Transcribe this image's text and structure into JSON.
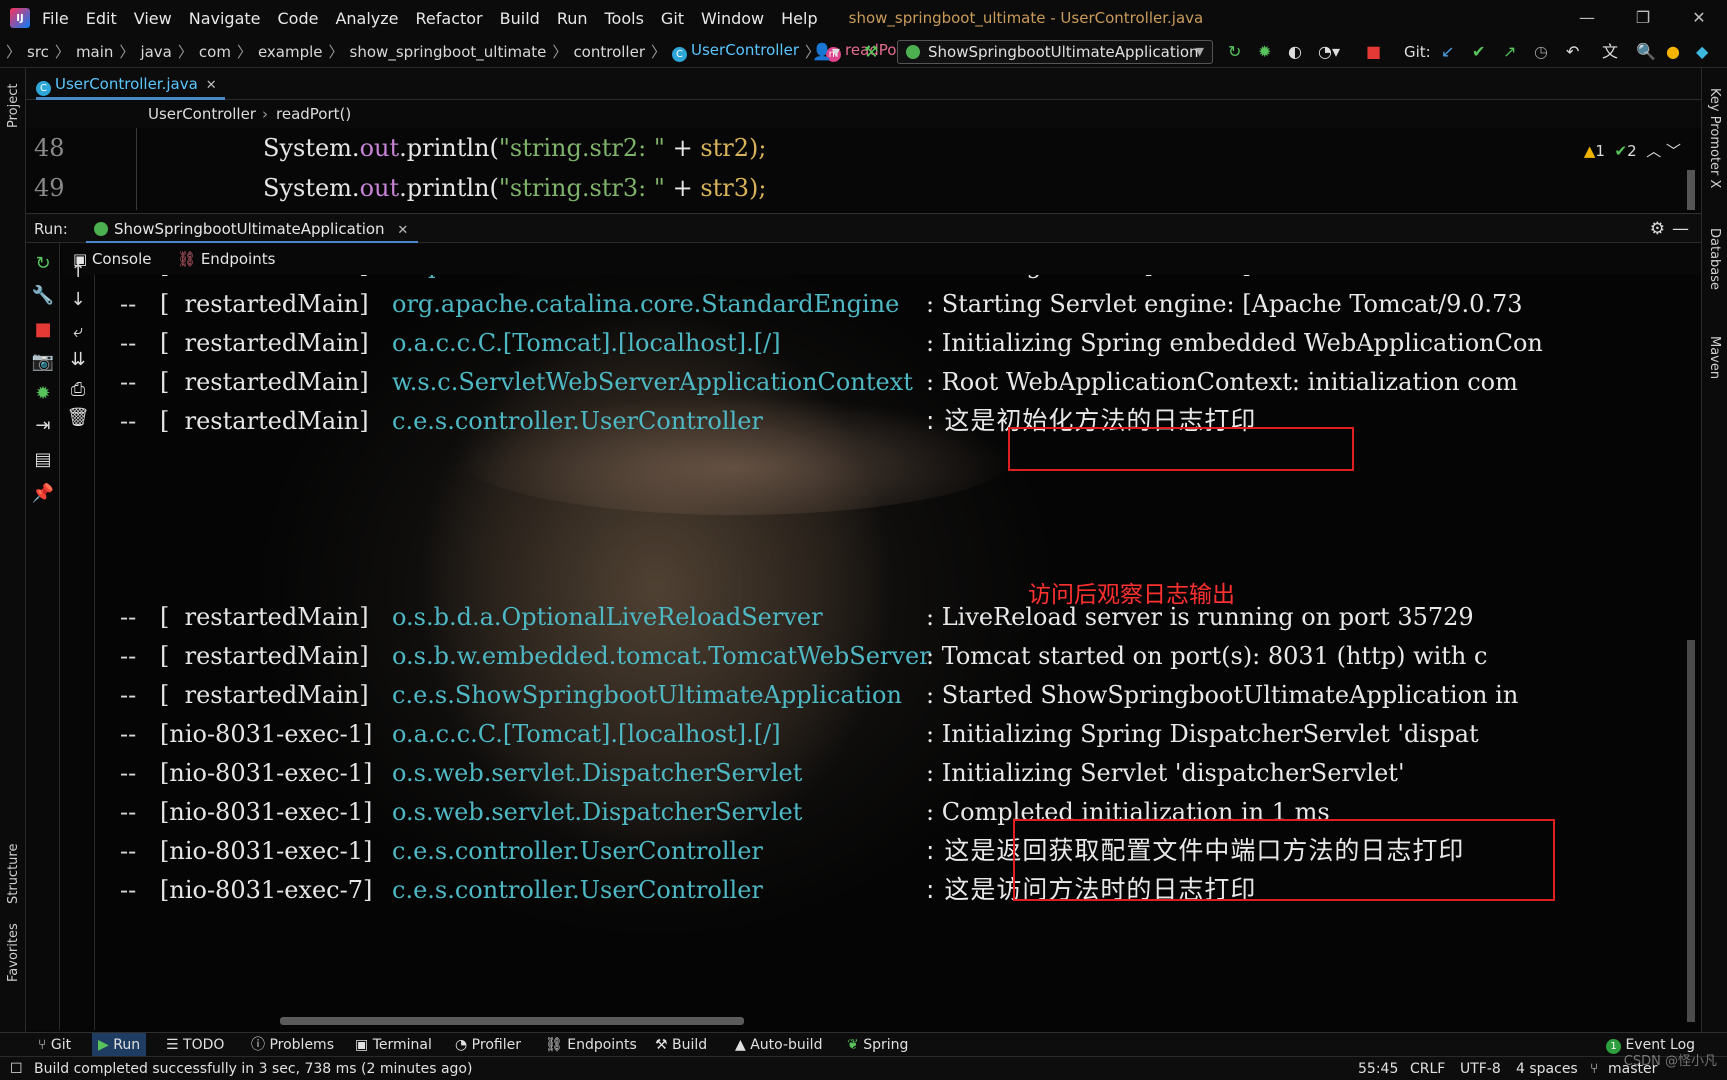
{
  "menu": {
    "items": [
      "File",
      "Edit",
      "View",
      "Navigate",
      "Code",
      "Analyze",
      "Refactor",
      "Build",
      "Run",
      "Tools",
      "Git",
      "Window",
      "Help"
    ],
    "title": "show_springboot_ultimate - UserController.java"
  },
  "window_controls": {
    "minimize": "—",
    "restore": "❐",
    "close": "✕"
  },
  "breadcrumb": [
    "src",
    "main",
    "java",
    "com",
    "example",
    "show_springboot_ultimate",
    "controller",
    "UserController",
    "readPort"
  ],
  "run_config": "ShowSpringbootUltimateApplication",
  "git_label": "Git:",
  "file_tab": {
    "label": "UserController.java",
    "close": "✕"
  },
  "editor_breadcrumb": {
    "class": "UserController",
    "method": "readPort()"
  },
  "code": [
    {
      "line": "48",
      "prefix": "System.",
      "field": "out",
      "mid": ".println(",
      "str": "\"string.str2: \"",
      "plus": " + ",
      "var": "str2",
      "end": ");"
    },
    {
      "line": "49",
      "prefix": "System.",
      "field": "out",
      "mid": ".println(",
      "str": "\"string.str3: \"",
      "plus": " + ",
      "var": "str3",
      "end": ");"
    }
  ],
  "inspections": {
    "warnings": "1",
    "ok": "2"
  },
  "run_panel": {
    "label": "Run:",
    "tab": "ShowSpringbootUltimateApplication",
    "close": "✕",
    "console_tab": "Console",
    "endpoints_tab": "Endpoints"
  },
  "side_labels": {
    "project": "Project",
    "structure": "Structure",
    "favorites": "Favorites",
    "key_promoter": "Key Promoter X",
    "database": "Database",
    "maven": "Maven"
  },
  "logs": [
    {
      "dash": "--",
      "thread": "[  restartedMain]",
      "cls": "o.apache.catalina.core.StandardService",
      "msg": ": Starting service [Tomcat]"
    },
    {
      "dash": "--",
      "thread": "[  restartedMain]",
      "cls": "org.apache.catalina.core.StandardEngine",
      "msg": ": Starting Servlet engine: [Apache Tomcat/9.0.73"
    },
    {
      "dash": "--",
      "thread": "[  restartedMain]",
      "cls": "o.a.c.c.C.[Tomcat].[localhost].[/]",
      "msg": ": Initializing Spring embedded WebApplicationCon"
    },
    {
      "dash": "--",
      "thread": "[  restartedMain]",
      "cls": "w.s.c.ServletWebServerApplicationContext",
      "msg": ": Root WebApplicationContext: initialization com"
    },
    {
      "dash": "--",
      "thread": "[  restartedMain]",
      "cls": "c.e.s.controller.UserController",
      "msg": ": 这是初始化方法的日志打印"
    },
    {
      "dash": "--",
      "thread": "[  restartedMain]",
      "cls": "o.s.b.d.a.OptionalLiveReloadServer",
      "msg": ": LiveReload server is running on port 35729"
    },
    {
      "dash": "--",
      "thread": "[  restartedMain]",
      "cls": "o.s.b.w.embedded.tomcat.TomcatWebServer",
      "msg": ": Tomcat started on port(s): 8031 (http) with c"
    },
    {
      "dash": "--",
      "thread": "[  restartedMain]",
      "cls": "c.e.s.ShowSpringbootUltimateApplication",
      "msg": ": Started ShowSpringbootUltimateApplication in"
    },
    {
      "dash": "--",
      "thread": "[nio-8031-exec-1]",
      "cls": "o.a.c.c.C.[Tomcat].[localhost].[/]",
      "msg": ": Initializing Spring DispatcherServlet 'dispat"
    },
    {
      "dash": "--",
      "thread": "[nio-8031-exec-1]",
      "cls": "o.s.web.servlet.DispatcherServlet",
      "msg": ": Initializing Servlet 'dispatcherServlet'"
    },
    {
      "dash": "--",
      "thread": "[nio-8031-exec-1]",
      "cls": "o.s.web.servlet.DispatcherServlet",
      "msg": ": Completed initialization in 1 ms"
    },
    {
      "dash": "--",
      "thread": "[nio-8031-exec-1]",
      "cls": "c.e.s.controller.UserController",
      "msg": ": 这是返回获取配置文件中端口方法的日志打印"
    },
    {
      "dash": "--",
      "thread": "[nio-8031-exec-7]",
      "cls": "c.e.s.controller.UserController",
      "msg": ": 这是访问方法时的日志打印"
    }
  ],
  "annotation": "访问后观察日志输出",
  "bottom_tools": [
    "Git",
    "Run",
    "TODO",
    "Problems",
    "Terminal",
    "Profiler",
    "Endpoints",
    "Build",
    "Auto-build",
    "Spring"
  ],
  "event_log": "Event Log",
  "event_count": "1",
  "status": {
    "message": "Build completed successfully in 3 sec, 738 ms (2 minutes ago)",
    "position": "55:45",
    "line_sep": "CRLF",
    "encoding": "UTF-8",
    "indent": "4 spaces",
    "branch": "master"
  },
  "watermark": "CSDN @怪小凡",
  "colors": {
    "class_name": "#4eb8c4",
    "highlight_box": "#e02020",
    "annotation": "#ff3030",
    "accent": "#4a88c7"
  }
}
